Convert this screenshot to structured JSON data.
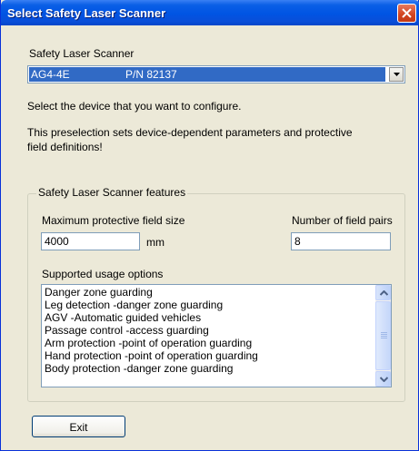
{
  "window": {
    "title": "Select Safety Laser Scanner"
  },
  "scanner": {
    "label": "Safety Laser Scanner",
    "selected_model": "AG4-4E",
    "selected_pn": "P/N  82137"
  },
  "instructions": {
    "line1": "Select the device that you want to configure.",
    "line2a": "This preselection sets device-dependent parameters and protective",
    "line2b": "field definitions!"
  },
  "features": {
    "group_title": "Safety Laser Scanner features",
    "max_field_label": "Maximum protective field size",
    "max_field_value": "4000",
    "max_field_unit": "mm",
    "pairs_label": "Number of field pairs",
    "pairs_value": "8",
    "usage_label": "Supported usage options",
    "usage_options": [
      "Danger zone guarding",
      "Leg detection  -danger zone guarding",
      "AGV  -Automatic guided vehicles",
      "Passage control  -access guarding",
      "Arm protection  -point of operation guarding",
      "Hand protection  -point of operation guarding",
      "Body protection  -danger zone guarding"
    ]
  },
  "buttons": {
    "exit": "Exit"
  }
}
